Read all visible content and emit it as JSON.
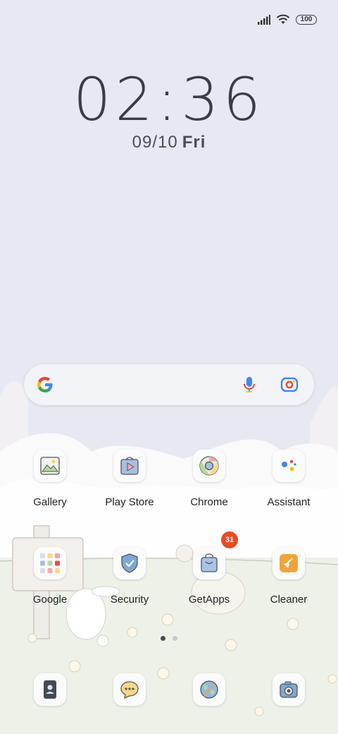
{
  "status_bar": {
    "battery": "100",
    "icons": [
      "signal-icon",
      "wifi-icon",
      "battery-icon"
    ]
  },
  "clock": {
    "time": "02:36",
    "date": "09/10",
    "day": "Fri"
  },
  "search_bar": {
    "icons": [
      "google-g-icon",
      "mic-icon",
      "lens-icon"
    ]
  },
  "apps": [
    {
      "label": "Gallery"
    },
    {
      "label": "Play Store"
    },
    {
      "label": "Chrome"
    },
    {
      "label": "Assistant"
    },
    {
      "label": "Google"
    },
    {
      "label": "Security"
    },
    {
      "label": "GetApps",
      "badge": "31"
    },
    {
      "label": "Cleaner"
    }
  ],
  "dock": {
    "icons": [
      "contacts-icon",
      "messages-icon",
      "browser-icon",
      "camera-icon"
    ]
  },
  "page_indicator": {
    "pages": 2,
    "current": 1
  },
  "colors": {
    "sky": "#e6e9f1",
    "badge": "#e84b24",
    "text": "#222222"
  }
}
